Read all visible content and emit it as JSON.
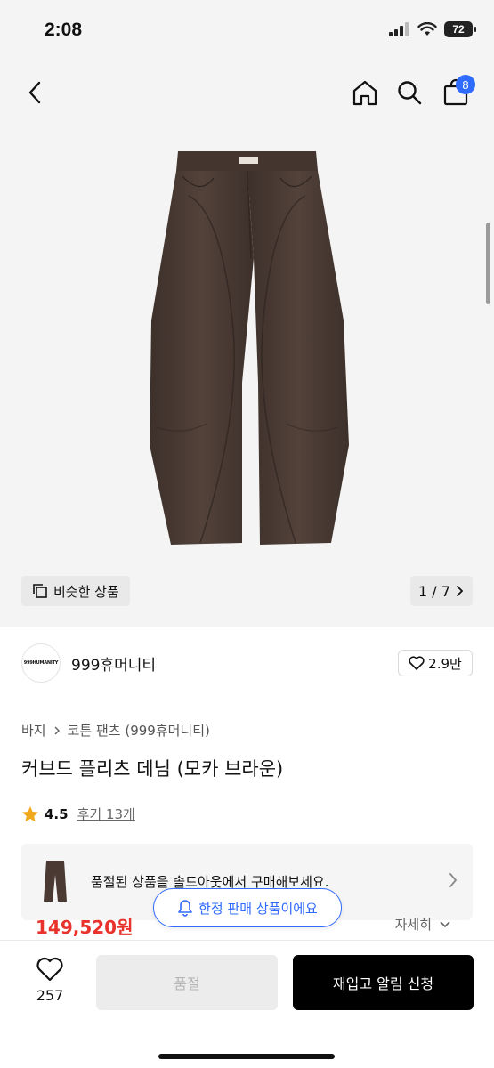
{
  "status_bar": {
    "time": "2:08",
    "battery": "72"
  },
  "header": {
    "cart_count": "8"
  },
  "gallery": {
    "similar_label": "비슷한 상품",
    "pager": "1 / 7"
  },
  "brand": {
    "logo_text": "999HUMANITY",
    "name": "999휴머니티",
    "likes": "2.9만"
  },
  "breadcrumb": {
    "category": "바지",
    "subcategory": "코튼 팬츠 (999휴머니티)"
  },
  "product": {
    "title": "커브드 플리츠 데님 (모카 브라운)"
  },
  "rating": {
    "value": "4.5",
    "reviews": "후기 13개"
  },
  "soldout_banner": {
    "text": "품절된 상품을 솔드아웃에서 구매해보세요."
  },
  "price": {
    "amount": "149,520원",
    "detail_label": "자세히"
  },
  "limited_pill": {
    "label": "한정 판매 상품이에요"
  },
  "bottom_bar": {
    "wish_count": "257",
    "soldout_label": "품절",
    "restock_label": "재입고 알림 신청"
  },
  "colors": {
    "accent_blue": "#2f6bff",
    "price_red": "#e8322b",
    "pants_brown": "#4a3a33"
  }
}
